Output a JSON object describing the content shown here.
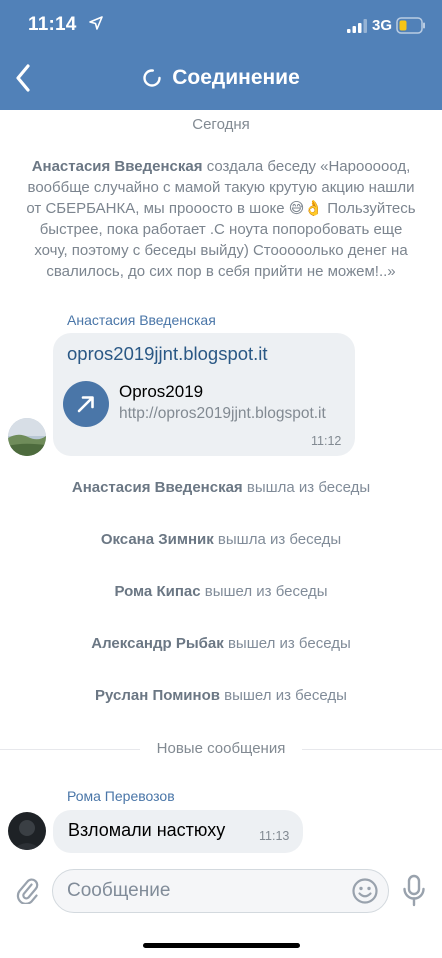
{
  "status_bar": {
    "time": "11:14",
    "network": "3G",
    "icons": [
      "location-arrow-icon",
      "signal-icon",
      "battery-icon"
    ]
  },
  "header": {
    "title": "Соединение",
    "back_icon": "chevron-left-icon",
    "spinner_icon": "spinner-icon",
    "bg_color": "#5181b8"
  },
  "chat": {
    "date_label": "Сегодня",
    "creation": {
      "author": "Анастасия Введенская",
      "text": "создала беседу «Нарооооод, вооббще случайно с мамой такую крутую акцию нашли  от СБЕРБАНКА, мы прооосто в шоке 😅👌 Пользуйтесь быстрее, пока работает .С ноута попоробовать еще хочу, поэтому с беседы выйду) Стооооолько денег на свалилось, до сих пор в себя прийти не можем!..»"
    },
    "link_message": {
      "sender": "Анастасия Введенская",
      "link_text": "opros2019jjnt.blogspot.it",
      "card_title": "Opros2019",
      "card_url": "http://opros2019jjnt.blogspot.it",
      "time": "11:12"
    },
    "system_events": [
      {
        "name": "Анастасия Введенская",
        "action": "вышла из беседы"
      },
      {
        "name": "Оксана Зимник",
        "action": "вышла из беседы"
      },
      {
        "name": "Рома Кипас",
        "action": "вышел из беседы"
      },
      {
        "name": "Александр Рыбак",
        "action": "вышел из беседы"
      },
      {
        "name": "Руслан Поминов",
        "action": "вышел из беседы"
      }
    ],
    "new_messages_label": "Новые сообщения",
    "last_message": {
      "sender": "Рома Перевозов",
      "text": "Взломали настюху",
      "time": "11:13"
    }
  },
  "composer": {
    "placeholder": "Сообщение",
    "value": ""
  },
  "colors": {
    "accent": "#5181b8",
    "link": "#2a5885",
    "sender": "#4a76a8",
    "muted": "#818c99",
    "bubble": "#edf0f3"
  }
}
